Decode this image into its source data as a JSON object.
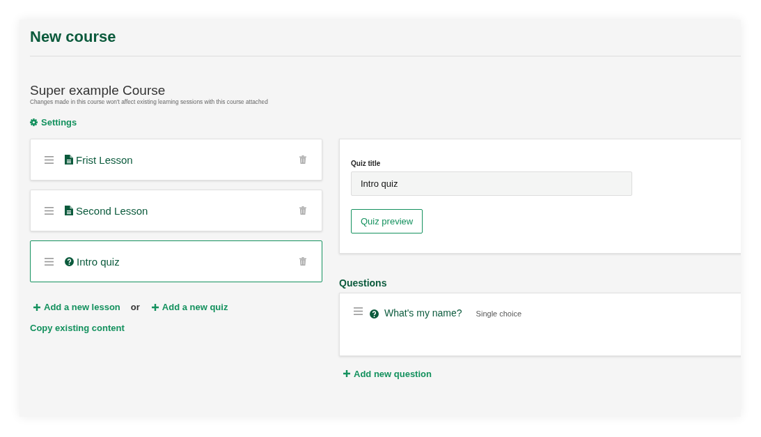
{
  "page": {
    "title": "New course"
  },
  "course": {
    "name": "Super example Course",
    "note": "Changes made in this course won't affect existing learning sessions with this course attached",
    "settings_link": "Settings"
  },
  "contents": [
    {
      "kind": "lesson",
      "title": "Frist Lesson",
      "selected": false
    },
    {
      "kind": "lesson",
      "title": "Second Lesson",
      "selected": false
    },
    {
      "kind": "quiz",
      "title": "Intro quiz",
      "selected": true
    }
  ],
  "actions": {
    "add_lesson": "Add a new lesson",
    "separator": "or",
    "add_quiz": "Add a new quiz",
    "copy": "Copy existing content"
  },
  "quiz": {
    "title_label": "Quiz title",
    "title_value": "Intro quiz",
    "preview_button": "Quiz preview"
  },
  "questions": {
    "heading": "Questions",
    "items": [
      {
        "text": "What's my name?",
        "type": "Single choice"
      }
    ],
    "add": "Add new question"
  }
}
